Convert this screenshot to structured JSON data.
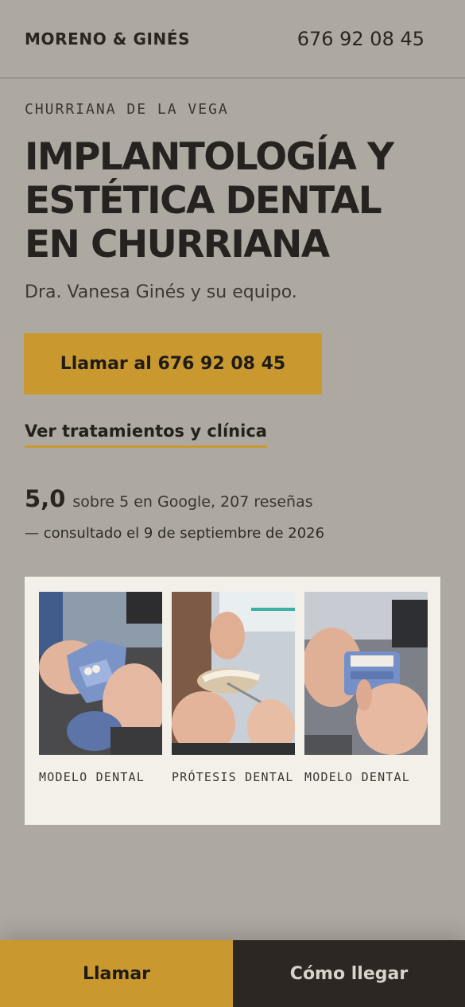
{
  "header": {
    "brand": "MORENO & GINÉS",
    "phone": "676 92 08 45"
  },
  "hero": {
    "kicker": "CHURRIANA DE LA VEGA",
    "title": "IMPLANTOLOGÍA Y ESTÉTICA DENTAL EN CHURRIANA",
    "subtitle": "Dra. Vanesa Ginés y su equipo.",
    "cta_label": "Llamar al 676 92 08 45",
    "link_label": "Ver tratamientos y clínica"
  },
  "rating": {
    "score": "5,0",
    "text": "sobre 5 en Google, 207 reseñas",
    "consulted": "— consultado el 9 de septiembre de 2026"
  },
  "gallery": [
    {
      "caption": "MODELO DENTAL",
      "image": "photo-dental-model-hands"
    },
    {
      "caption": "PRÓTESIS DENTAL",
      "image": "photo-dental-prosthesis"
    },
    {
      "caption": "MODELO DENTAL",
      "image": "photo-dental-model-teeth"
    }
  ],
  "bottom_bar": {
    "call_label": "Llamar",
    "directions_label": "Cómo llegar"
  },
  "colors": {
    "background": "#aea9a0",
    "accent": "#c9992f",
    "dark": "#2c2722",
    "card": "#f3f0ea"
  }
}
